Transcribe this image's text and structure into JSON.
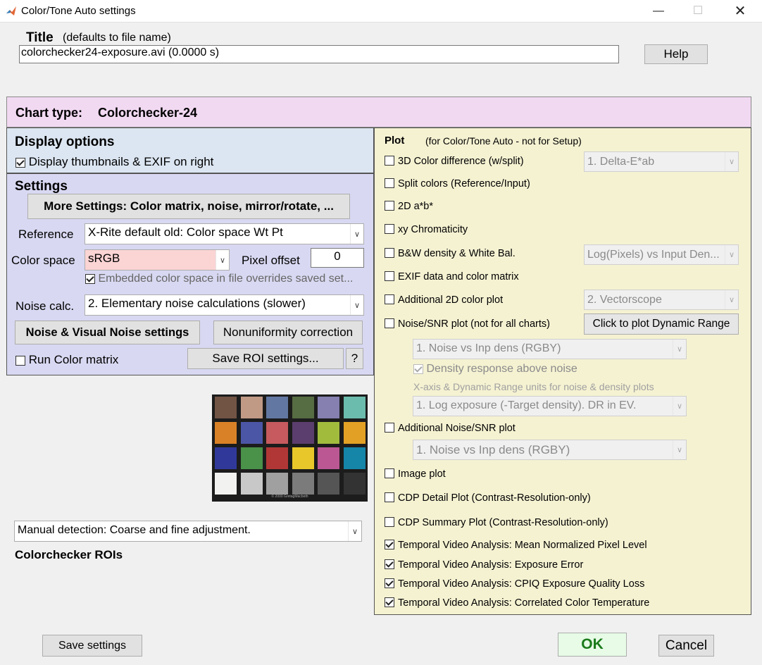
{
  "window": {
    "title": "Color/Tone Auto settings"
  },
  "title_section": {
    "label": "Title",
    "sublabel": "(defaults to file name)",
    "value": "colorchecker24-exposure.avi (0.0000 s)",
    "help_label": "Help"
  },
  "chart_type": {
    "label": "Chart type:",
    "value": "Colorchecker-24"
  },
  "display_options": {
    "heading": "Display options",
    "thumbnails_label": "Display thumbnails & EXIF on right",
    "thumbnails_checked": true
  },
  "settings": {
    "heading": "Settings",
    "more_settings_label": "More Settings:  Color matrix, noise, mirror/rotate, ...",
    "reference_label": "Reference",
    "reference_value": "X-Rite default old: Color space Wt Pt",
    "color_space_label": "Color space",
    "color_space_value": "sRGB",
    "pixel_offset_label": "Pixel offset",
    "pixel_offset_value": "0",
    "embedded_label": "Embedded color space in file overrides saved set...",
    "noise_calc_label": "Noise calc.",
    "noise_calc_value": "2. Elementary noise calculations (slower)",
    "noise_visual_label": "Noise & Visual Noise settings",
    "nonuniformity_label": "Nonuniformity correction",
    "run_matrix_label": "Run Color matrix",
    "save_roi_label": "Save ROI settings...",
    "question_label": "?"
  },
  "thumbnail": {
    "colors": [
      "#725445",
      "#c19a86",
      "#6278a2",
      "#566c42",
      "#8580b0",
      "#6bbcac",
      "#d98127",
      "#4c56a6",
      "#c65a5e",
      "#5c3e6e",
      "#a1bb3d",
      "#e2a125",
      "#30399a",
      "#4a914a",
      "#b13736",
      "#e8c72a",
      "#bb5793",
      "#1585a8",
      "#f2f2f0",
      "#c8c8c8",
      "#a0a0a0",
      "#7b7b7b",
      "#555555",
      "#333333"
    ],
    "caption": "© 2000 GretagMacbeth"
  },
  "detection": {
    "value": "Manual detection:   Coarse and fine adjustment.",
    "rois_label": "Colorchecker ROIs"
  },
  "plot": {
    "heading": "Plot",
    "subheading": "(for Color/Tone Auto - not for Setup)",
    "items": [
      {
        "label": "3D Color difference (w/split)",
        "checked": false
      },
      {
        "label": "Split colors (Reference/Input)",
        "checked": false
      },
      {
        "label": "2D a*b*",
        "checked": false
      },
      {
        "label": "xy Chromaticity",
        "checked": false
      },
      {
        "label": "B&W density & White Bal.",
        "checked": false
      },
      {
        "label": "EXIF data and color matrix",
        "checked": false
      },
      {
        "label": "Additional 2D color plot",
        "checked": false
      },
      {
        "label": "Noise/SNR plot (not for all charts)",
        "checked": false
      },
      {
        "label": "Additional Noise/SNR plot",
        "checked": false
      },
      {
        "label": "Image plot",
        "checked": false
      },
      {
        "label": "CDP Detail Plot (Contrast-Resolution-only)",
        "checked": false
      },
      {
        "label": "CDP Summary Plot (Contrast-Resolution-only)",
        "checked": false
      },
      {
        "label": "Temporal Video Analysis: Mean Normalized Pixel Level",
        "checked": true
      },
      {
        "label": "Temporal Video Analysis: Exposure Error",
        "checked": true
      },
      {
        "label": "Temporal Video Analysis: CPIQ Exposure Quality Loss",
        "checked": true
      },
      {
        "label": "Temporal Video Analysis: Correlated Color Temperature",
        "checked": true
      }
    ],
    "delta_e_value": "1.  Delta-E*ab",
    "bw_density_value": "Log(Pixels) vs Input Den...",
    "color_plot_value": "2. Vectorscope",
    "dynamic_range_label": "Click to plot Dynamic Range",
    "noise_plot_value": "1.  Noise vs Inp dens (RGBY)",
    "density_response_label": "Density response above noise",
    "xaxis_label": "X-axis & Dynamic Range units for noise & density plots",
    "exposure_value": "1. Log exposure (-Target density).    DR in EV.",
    "noise_plot2_value": "1.  Noise vs Inp dens (RGBY)"
  },
  "footer": {
    "save_settings_label": "Save settings",
    "ok_label": "OK",
    "cancel_label": "Cancel"
  }
}
